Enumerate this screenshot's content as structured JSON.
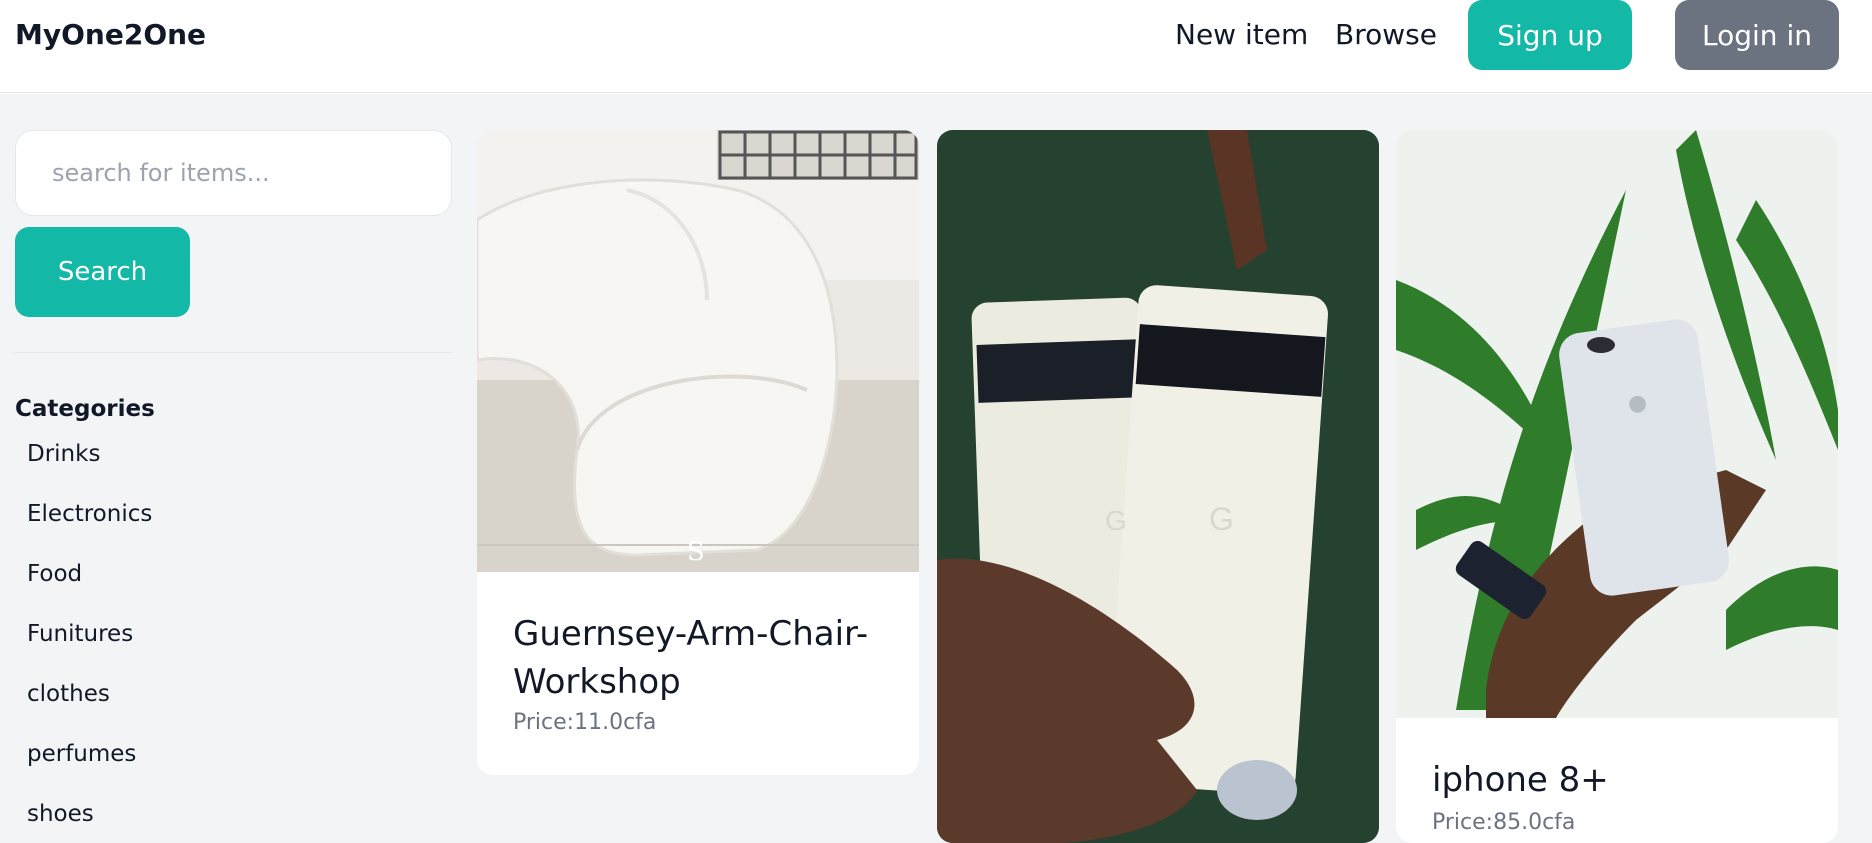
{
  "navbar": {
    "brand": "MyOne2One",
    "new_item": "New item",
    "browse": "Browse",
    "signup": "Sign up",
    "login": "Login in"
  },
  "sidebar": {
    "search_placeholder": "search for items...",
    "search_button": "Search",
    "categories_title": "Categories",
    "categories": [
      "Drinks",
      "Electronics",
      "Food",
      "Funitures",
      "clothes",
      "perfumes",
      "shoes"
    ]
  },
  "items": [
    {
      "title": "Guernsey-Arm-Chair-Workshop",
      "price": "Price:11.0cfa",
      "image": "white-sofa-photo"
    },
    {
      "title": "",
      "price": "",
      "image": "google-pixel-phones-photo"
    },
    {
      "title": "iphone 8+",
      "price": "Price:85.0cfa",
      "image": "iphone-in-hand-photo"
    }
  ],
  "colors": {
    "accent": "#14b8a6",
    "secondary": "#6b7280",
    "background": "#f3f4f6"
  }
}
